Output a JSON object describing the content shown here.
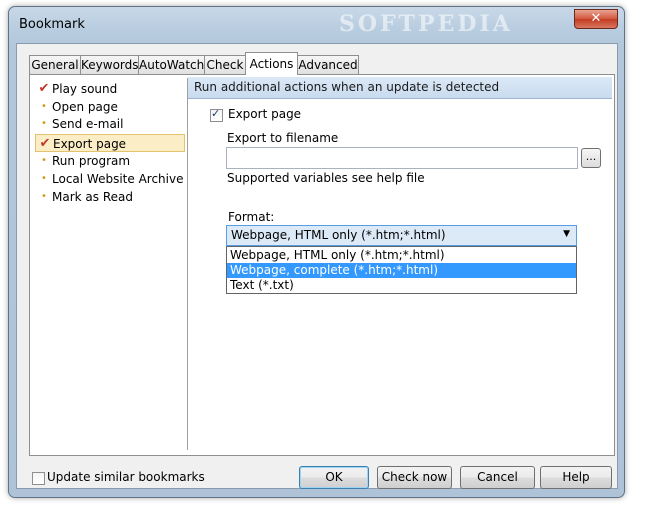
{
  "window": {
    "title": "Bookmark",
    "watermark": "SOFTPEDIA",
    "close_label": "✕"
  },
  "tabs": [
    {
      "label": "General",
      "active": false
    },
    {
      "label": "Keywords",
      "active": false
    },
    {
      "label": "AutoWatch",
      "active": false
    },
    {
      "label": "Check",
      "active": false
    },
    {
      "label": "Actions",
      "active": true
    },
    {
      "label": "Advanced",
      "active": false
    }
  ],
  "actions_list": [
    {
      "label": "Play sound",
      "marker": "check"
    },
    {
      "label": "Open page",
      "marker": "dot"
    },
    {
      "label": "Send e-mail",
      "marker": "dot"
    },
    {
      "label": "Export page",
      "marker": "check",
      "selected": true
    },
    {
      "label": "Run program",
      "marker": "dot"
    },
    {
      "label": "Local Website Archive",
      "marker": "dot"
    },
    {
      "label": "Mark as Read",
      "marker": "dot"
    }
  ],
  "detail": {
    "header": "Run additional actions when an update is detected",
    "export_checkbox": {
      "label": "Export page",
      "checked": true
    },
    "filename_label": "Export to filename",
    "filename_value": "",
    "browse_label": "...",
    "help_text": "Supported variables see help file",
    "format_label": "Format:",
    "format_selected": "Webpage, HTML only (*.htm;*.html)",
    "format_options": [
      "Webpage, HTML only (*.htm;*.html)",
      "Webpage, complete (*.htm;*.html)",
      "Text (*.txt)"
    ],
    "highlighted_option_index": 1
  },
  "footer": {
    "update_similar": {
      "label": "Update similar bookmarks",
      "checked": false
    },
    "ok_label": "OK",
    "check_now_label": "Check now",
    "cancel_label": "Cancel",
    "help_label": "Help"
  },
  "colors": {
    "highlight": "#3399ff",
    "header_bg": "#c9dbef",
    "check_mark": "#c0392b",
    "dot_mark": "#d49a1a"
  }
}
